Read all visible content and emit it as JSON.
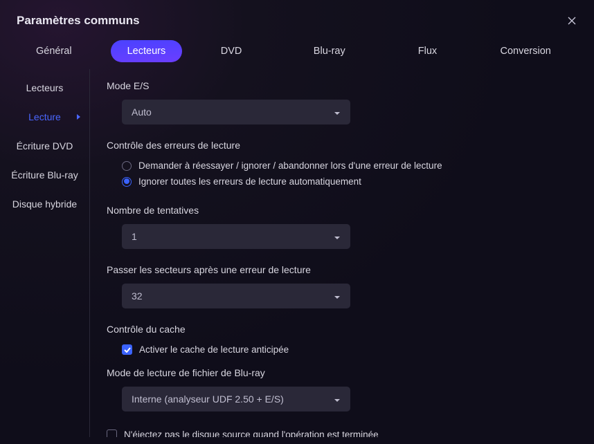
{
  "window": {
    "title": "Paramètres communs"
  },
  "tabs": {
    "general": "Général",
    "drives": "Lecteurs",
    "dvd": "DVD",
    "bluray": "Blu-ray",
    "flux": "Flux",
    "conversion": "Conversion"
  },
  "sidebar": {
    "items": [
      {
        "label": "Lecteurs"
      },
      {
        "label": "Lecture"
      },
      {
        "label": "Écriture DVD"
      },
      {
        "label": "Écriture Blu-ray"
      },
      {
        "label": "Disque hybride"
      }
    ]
  },
  "io_mode": {
    "label": "Mode E/S",
    "value": "Auto"
  },
  "error_control": {
    "heading": "Contrôle des erreurs de lecture",
    "opt_ask": "Demander à réessayer / ignorer / abandonner lors d'une erreur de lecture",
    "opt_ignore": "Ignorer toutes les erreurs de lecture automatiquement"
  },
  "retry": {
    "label": "Nombre de tentatives",
    "value": "1"
  },
  "skip": {
    "label": "Passer les secteurs après une erreur de lecture",
    "value": "32"
  },
  "cache": {
    "heading": "Contrôle du cache",
    "enable_label": "Activer le cache de lecture anticipée"
  },
  "br_mode": {
    "label": "Mode de lecture de fichier de Blu-ray",
    "value": "Interne (analyseur UDF 2.50 + E/S)"
  },
  "eject": {
    "label": "N'éjectez pas le disque source quand l'opération est terminée"
  }
}
